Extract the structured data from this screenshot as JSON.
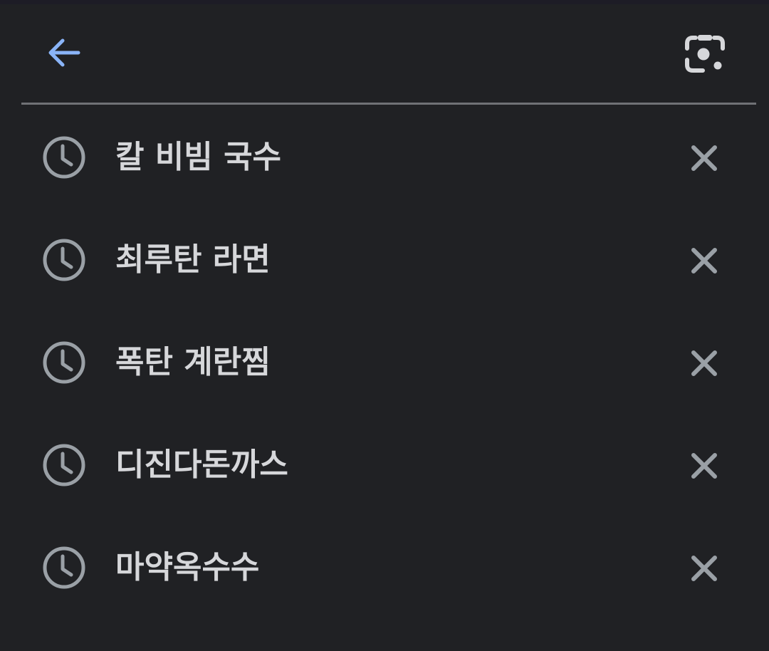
{
  "search": {
    "value": "",
    "placeholder": ""
  },
  "icons": {
    "back": "arrow-left-icon",
    "lens": "google-lens-icon",
    "history": "clock-icon",
    "remove": "close-icon"
  },
  "colors": {
    "background": "#202124",
    "accent": "#8ab4f8",
    "text": "#d6d7da",
    "icon": "#9aa0a6"
  },
  "history": {
    "items": [
      {
        "label": "칼 비빔 국수"
      },
      {
        "label": "최루탄 라면"
      },
      {
        "label": "폭탄 계란찜"
      },
      {
        "label": "디진다돈까스"
      },
      {
        "label": "마약옥수수"
      }
    ]
  }
}
